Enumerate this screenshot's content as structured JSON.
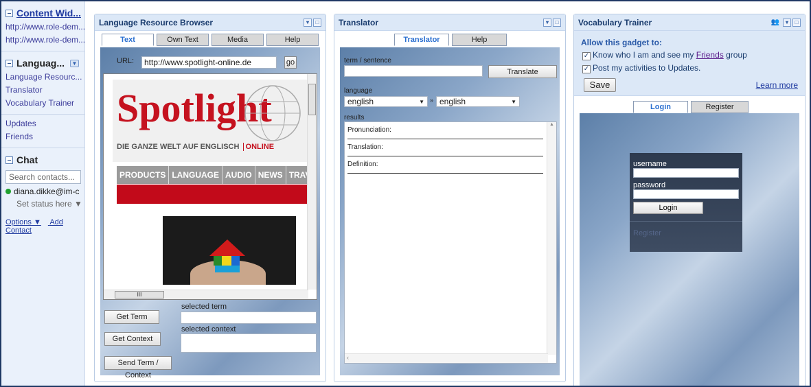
{
  "sidebar": {
    "content_widgets": {
      "title": "Content Wid...",
      "links": [
        "http://www.role-dem...",
        "http://www.role-dem..."
      ]
    },
    "language": {
      "title": "Languag...",
      "items": [
        "Language Resourc...",
        "Translator",
        "Vocabulary Trainer"
      ]
    },
    "nav": [
      "Updates",
      "Friends"
    ],
    "chat": {
      "title": "Chat",
      "search_placeholder": "Search contacts...",
      "contact": "diana.dikke@im-c",
      "status": "Set status here ▼",
      "options": "Options ▼",
      "add_contact": "Add Contact"
    }
  },
  "lrb": {
    "title": "Language Resource Browser",
    "tabs": [
      "Text",
      "Own Text",
      "Media",
      "Help"
    ],
    "url_label": "URL:",
    "url_value": "http://www.spotlight-online.de",
    "go": "go",
    "site": {
      "logo": "Spotlight",
      "tagline": "DIE GANZE WELT AUF ENGLISCH",
      "online": "ONLINE",
      "nav": [
        "PRODUCTS",
        "LANGUAGE",
        "AUDIO",
        "NEWS",
        "TRAVE"
      ]
    },
    "scroll_mark": "III",
    "get_term": "Get Term",
    "get_context": "Get Context",
    "send": "Send Term / Context",
    "selected_term": "selected term",
    "selected_context": "selected context"
  },
  "translator": {
    "title": "Translator",
    "tabs": [
      "Translator",
      "Help"
    ],
    "term_label": "term / sentence",
    "translate": "Translate",
    "language_label": "language",
    "from": "english",
    "to": "english",
    "results_label": "results",
    "results": [
      "Pronunciation:",
      "Translation:",
      "Definition:"
    ]
  },
  "vocab": {
    "title": "Vocabulary Trainer",
    "allow": "Allow this gadget to:",
    "perm1_prefix": "Know who I am and see my ",
    "perm1_link": "Friends",
    "perm1_suffix": " group",
    "perm2": "Post my activities to Updates.",
    "save": "Save",
    "learn_more": "Learn more",
    "tabs": [
      "Login",
      "Register"
    ],
    "username": "username",
    "password": "password",
    "login": "Login",
    "register": "Register"
  }
}
